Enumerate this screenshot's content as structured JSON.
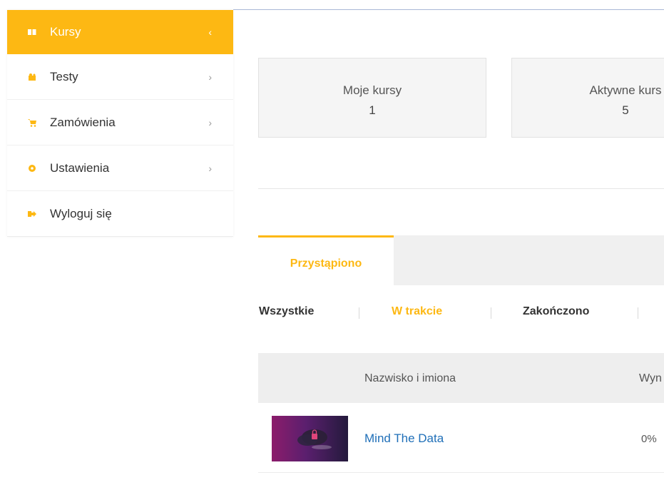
{
  "sidebar": {
    "items": [
      {
        "label": "Kursy",
        "icon": "book-icon",
        "active": true
      },
      {
        "label": "Testy",
        "icon": "puzzle-icon",
        "active": false
      },
      {
        "label": "Zamówienia",
        "icon": "cart-icon",
        "active": false
      },
      {
        "label": "Ustawienia",
        "icon": "gear-icon",
        "active": false
      },
      {
        "label": "Wyloguj się",
        "icon": "logout-icon",
        "active": false
      }
    ]
  },
  "stats": [
    {
      "label": "Moje kursy",
      "value": "1"
    },
    {
      "label": "Aktywne kurs",
      "value": "5"
    }
  ],
  "tabs": {
    "active_label": "Przystąpiono"
  },
  "filters": [
    {
      "label": "Wszystkie",
      "active": false
    },
    {
      "label": "W trakcie",
      "active": true
    },
    {
      "label": "Zakończono",
      "active": false
    }
  ],
  "table": {
    "headers": [
      "Nazwisko i imiona",
      "Wyn"
    ],
    "rows": [
      {
        "title": "Mind The Data",
        "progress": "0%"
      }
    ]
  },
  "colors": {
    "accent": "#fdb813",
    "link": "#1f6fb8"
  }
}
